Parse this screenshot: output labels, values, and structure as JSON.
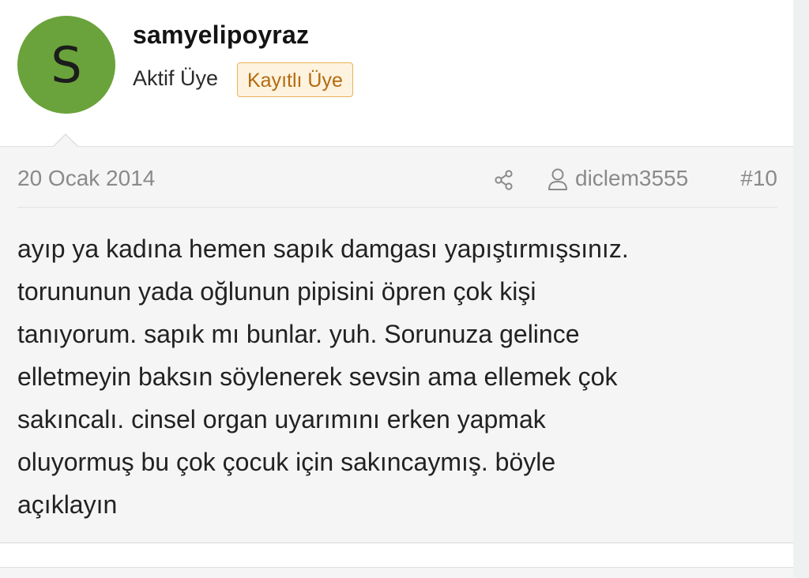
{
  "user": {
    "avatar_letter": "S",
    "avatar_color": "#6aa33b",
    "username": "samyelipoyraz",
    "title": "Aktif Üye",
    "badge": "Kayıtlı Üye"
  },
  "post": {
    "date": "20 Ocak 2014",
    "share_icon": "share-icon",
    "user_icon": "user-icon",
    "author": "diclem3555",
    "number": "#10",
    "body_lines": [
      "ayıp ya kadına hemen sapık damgası yapıştırmışsınız.",
      "torununun yada oğlunun pipisini öpren çok kişi",
      "tanıyorum. sapık mı bunlar. yuh. Sorunuza gelince",
      "elletmeyin baksın söylenerek sevsin ama ellemek çok",
      "sakıncalı. cinsel organ uyarımını erken yapmak",
      "oluyormuş bu çok çocuk için sakıncaymış. böyle",
      "açıklayın"
    ]
  },
  "colors": {
    "badge_text": "#b46a0d",
    "badge_bg": "#fdf3df",
    "badge_border": "#e8b25a",
    "meta_text": "#8a8a8a"
  }
}
